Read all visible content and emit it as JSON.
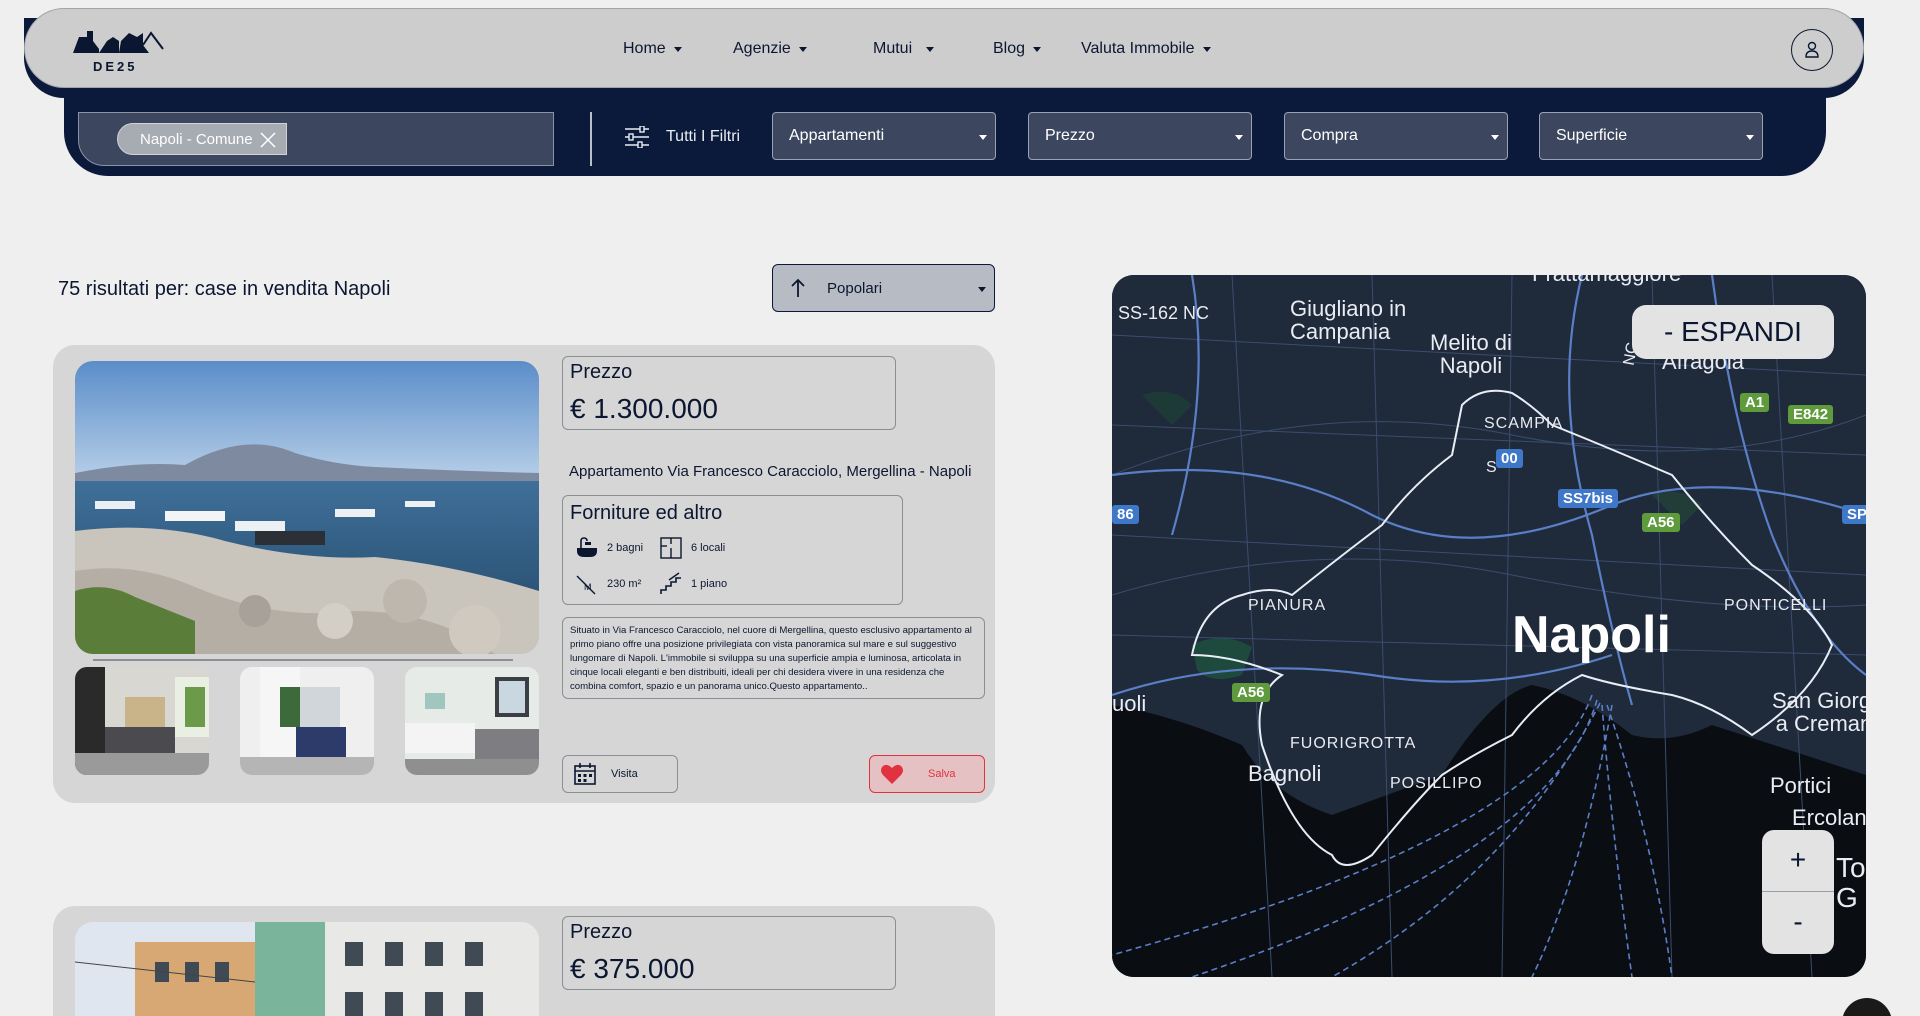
{
  "brand": {
    "name": "DE25"
  },
  "nav": {
    "items": [
      {
        "label": "Home"
      },
      {
        "label": "Agenzie"
      },
      {
        "label": "Mutui"
      },
      {
        "label": "Blog"
      },
      {
        "label": "Valuta Immobile"
      }
    ]
  },
  "filters": {
    "location_chip": "Napoli - Comune",
    "all_filters_label": "Tutti I Filtri",
    "selects": [
      {
        "label": "Appartamenti"
      },
      {
        "label": "Prezzo"
      },
      {
        "label": "Compra"
      },
      {
        "label": "Superficie"
      }
    ]
  },
  "results": {
    "title": "75 risultati per: case in vendita Napoli",
    "sort_label": "Popolari"
  },
  "listings": [
    {
      "price_label": "Prezzo",
      "price": "€ 1.300.000",
      "title": "Appartamento Via Francesco Caracciolo, Mergellina - Napoli",
      "features_title": "Forniture ed altro",
      "features": {
        "bathrooms": "2 bagni",
        "rooms": "6 locali",
        "area": "230 m²",
        "floor": "1 piano"
      },
      "description": "Situato in Via Francesco Caracciolo, nel cuore di Mergellina, questo esclusivo appartamento al primo piano offre una posizione privilegiata con vista panoramica sul mare e sul suggestivo lungomare di Napoli. L'immobile si sviluppa su una superficie ampia e luminosa, articolata in cinque locali eleganti e ben distribuiti, ideali per chi desidera vivere in una residenza che combina comfort, spazio e un panorama unico.Questo appartamento..",
      "visit_label": "Visita",
      "save_label": "Salva"
    },
    {
      "price_label": "Prezzo",
      "price": "€ 375.000"
    }
  ],
  "map": {
    "expand_label": "- ESPANDI",
    "zoom_in": "+",
    "zoom_out": "-",
    "labels": {
      "frattamaggiore": "Frattamaggiore",
      "ss162": "SS-162 NC",
      "giugliano": "Giugliano in\nCampania",
      "melito": "Melito di\nNapoli",
      "afragola": "Afragola",
      "nc": "NC",
      "scampia": "SCAMPIA",
      "pianura": "PIANURA",
      "napoli": "Napoli",
      "ponticelli": "PONTICELLI",
      "quarto": "uoli",
      "fuorigrotta": "FUORIGROTTA",
      "bagnoli": "Bagnoli",
      "posillipo": "POSILLIPO",
      "sangiorgio": "San Giorgio\na Cremano",
      "portici": "Portici",
      "ercolano": "Ercolan",
      "torre": "To\nG"
    },
    "shields": {
      "a1": "A1",
      "e842": "E842",
      "ss7bis": "SS7bis",
      "a56_ne": "A56",
      "a56_w": "A56",
      "r00": "00",
      "r86": "86",
      "sp": "SP",
      "s": "S"
    }
  }
}
